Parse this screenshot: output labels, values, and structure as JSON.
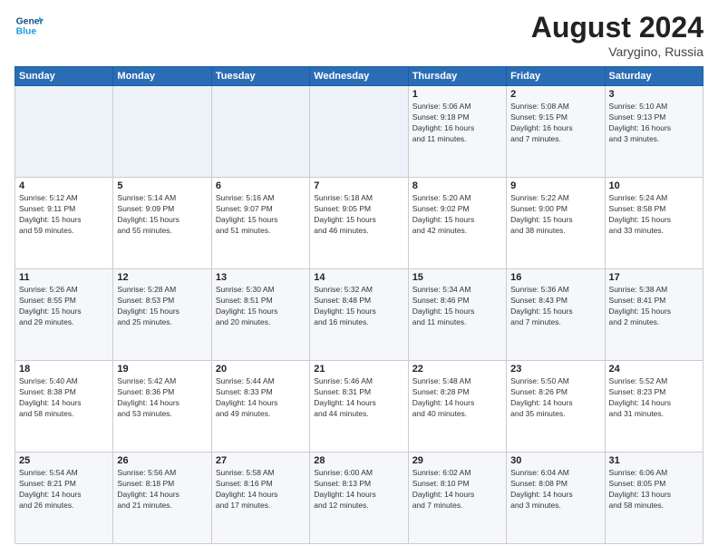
{
  "header": {
    "logo_line1": "General",
    "logo_line2": "Blue",
    "month_year": "August 2024",
    "location": "Varygino, Russia"
  },
  "days_of_week": [
    "Sunday",
    "Monday",
    "Tuesday",
    "Wednesday",
    "Thursday",
    "Friday",
    "Saturday"
  ],
  "weeks": [
    {
      "days": [
        {
          "num": "",
          "info": ""
        },
        {
          "num": "",
          "info": ""
        },
        {
          "num": "",
          "info": ""
        },
        {
          "num": "",
          "info": ""
        },
        {
          "num": "1",
          "info": "Sunrise: 5:06 AM\nSunset: 9:18 PM\nDaylight: 16 hours\nand 11 minutes."
        },
        {
          "num": "2",
          "info": "Sunrise: 5:08 AM\nSunset: 9:15 PM\nDaylight: 16 hours\nand 7 minutes."
        },
        {
          "num": "3",
          "info": "Sunrise: 5:10 AM\nSunset: 9:13 PM\nDaylight: 16 hours\nand 3 minutes."
        }
      ]
    },
    {
      "days": [
        {
          "num": "4",
          "info": "Sunrise: 5:12 AM\nSunset: 9:11 PM\nDaylight: 15 hours\nand 59 minutes."
        },
        {
          "num": "5",
          "info": "Sunrise: 5:14 AM\nSunset: 9:09 PM\nDaylight: 15 hours\nand 55 minutes."
        },
        {
          "num": "6",
          "info": "Sunrise: 5:16 AM\nSunset: 9:07 PM\nDaylight: 15 hours\nand 51 minutes."
        },
        {
          "num": "7",
          "info": "Sunrise: 5:18 AM\nSunset: 9:05 PM\nDaylight: 15 hours\nand 46 minutes."
        },
        {
          "num": "8",
          "info": "Sunrise: 5:20 AM\nSunset: 9:02 PM\nDaylight: 15 hours\nand 42 minutes."
        },
        {
          "num": "9",
          "info": "Sunrise: 5:22 AM\nSunset: 9:00 PM\nDaylight: 15 hours\nand 38 minutes."
        },
        {
          "num": "10",
          "info": "Sunrise: 5:24 AM\nSunset: 8:58 PM\nDaylight: 15 hours\nand 33 minutes."
        }
      ]
    },
    {
      "days": [
        {
          "num": "11",
          "info": "Sunrise: 5:26 AM\nSunset: 8:55 PM\nDaylight: 15 hours\nand 29 minutes."
        },
        {
          "num": "12",
          "info": "Sunrise: 5:28 AM\nSunset: 8:53 PM\nDaylight: 15 hours\nand 25 minutes."
        },
        {
          "num": "13",
          "info": "Sunrise: 5:30 AM\nSunset: 8:51 PM\nDaylight: 15 hours\nand 20 minutes."
        },
        {
          "num": "14",
          "info": "Sunrise: 5:32 AM\nSunset: 8:48 PM\nDaylight: 15 hours\nand 16 minutes."
        },
        {
          "num": "15",
          "info": "Sunrise: 5:34 AM\nSunset: 8:46 PM\nDaylight: 15 hours\nand 11 minutes."
        },
        {
          "num": "16",
          "info": "Sunrise: 5:36 AM\nSunset: 8:43 PM\nDaylight: 15 hours\nand 7 minutes."
        },
        {
          "num": "17",
          "info": "Sunrise: 5:38 AM\nSunset: 8:41 PM\nDaylight: 15 hours\nand 2 minutes."
        }
      ]
    },
    {
      "days": [
        {
          "num": "18",
          "info": "Sunrise: 5:40 AM\nSunset: 8:38 PM\nDaylight: 14 hours\nand 58 minutes."
        },
        {
          "num": "19",
          "info": "Sunrise: 5:42 AM\nSunset: 8:36 PM\nDaylight: 14 hours\nand 53 minutes."
        },
        {
          "num": "20",
          "info": "Sunrise: 5:44 AM\nSunset: 8:33 PM\nDaylight: 14 hours\nand 49 minutes."
        },
        {
          "num": "21",
          "info": "Sunrise: 5:46 AM\nSunset: 8:31 PM\nDaylight: 14 hours\nand 44 minutes."
        },
        {
          "num": "22",
          "info": "Sunrise: 5:48 AM\nSunset: 8:28 PM\nDaylight: 14 hours\nand 40 minutes."
        },
        {
          "num": "23",
          "info": "Sunrise: 5:50 AM\nSunset: 8:26 PM\nDaylight: 14 hours\nand 35 minutes."
        },
        {
          "num": "24",
          "info": "Sunrise: 5:52 AM\nSunset: 8:23 PM\nDaylight: 14 hours\nand 31 minutes."
        }
      ]
    },
    {
      "days": [
        {
          "num": "25",
          "info": "Sunrise: 5:54 AM\nSunset: 8:21 PM\nDaylight: 14 hours\nand 26 minutes."
        },
        {
          "num": "26",
          "info": "Sunrise: 5:56 AM\nSunset: 8:18 PM\nDaylight: 14 hours\nand 21 minutes."
        },
        {
          "num": "27",
          "info": "Sunrise: 5:58 AM\nSunset: 8:16 PM\nDaylight: 14 hours\nand 17 minutes."
        },
        {
          "num": "28",
          "info": "Sunrise: 6:00 AM\nSunset: 8:13 PM\nDaylight: 14 hours\nand 12 minutes."
        },
        {
          "num": "29",
          "info": "Sunrise: 6:02 AM\nSunset: 8:10 PM\nDaylight: 14 hours\nand 7 minutes."
        },
        {
          "num": "30",
          "info": "Sunrise: 6:04 AM\nSunset: 8:08 PM\nDaylight: 14 hours\nand 3 minutes."
        },
        {
          "num": "31",
          "info": "Sunrise: 6:06 AM\nSunset: 8:05 PM\nDaylight: 13 hours\nand 58 minutes."
        }
      ]
    }
  ]
}
